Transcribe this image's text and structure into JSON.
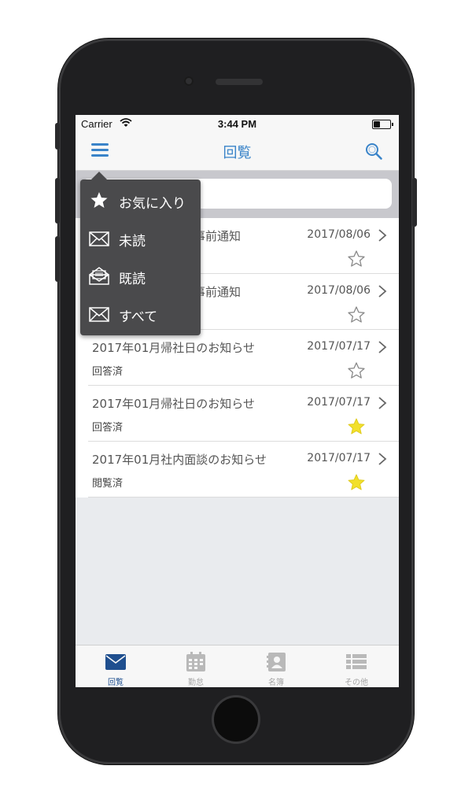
{
  "status_bar": {
    "carrier": "Carrier",
    "time": "3:44 PM",
    "battery_fraction": 0.45
  },
  "nav": {
    "title": "回覧",
    "menu_icon": "menu-icon",
    "search_icon": "search-icon"
  },
  "dropdown": {
    "items": [
      {
        "label": "お気に入り",
        "icon": "star-icon"
      },
      {
        "label": "未読",
        "icon": "envelope-closed-icon"
      },
      {
        "label": "既読",
        "icon": "envelope-open-icon"
      },
      {
        "label": "すべて",
        "icon": "envelope-all-icon"
      }
    ]
  },
  "list": {
    "items": [
      {
        "title": "事前通知",
        "date": "2017/08/06",
        "status": "",
        "favorite": false
      },
      {
        "title": "事前通知",
        "date": "2017/08/06",
        "status": "",
        "favorite": false
      },
      {
        "title": "2017年01月帰社日のお知らせ",
        "date": "2017/07/17",
        "status": "回答済",
        "favorite": false
      },
      {
        "title": "2017年01月帰社日のお知らせ",
        "date": "2017/07/17",
        "status": "回答済",
        "favorite": true
      },
      {
        "title": "2017年01月社内面談のお知らせ",
        "date": "2017/07/17",
        "status": "閲覧済",
        "favorite": true
      }
    ]
  },
  "tabbar": {
    "tabs": [
      {
        "label": "回覧",
        "icon": "mail-icon",
        "active": true
      },
      {
        "label": "勤怠",
        "icon": "calendar-icon",
        "active": false
      },
      {
        "label": "名簿",
        "icon": "contacts-icon",
        "active": false
      },
      {
        "label": "その他",
        "icon": "list-icon",
        "active": false
      }
    ]
  },
  "colors": {
    "accent": "#3a84c9",
    "tab_active": "#1f4f8f",
    "star_filled": "#f2e02b",
    "menu_bg": "#4a4a4c"
  }
}
